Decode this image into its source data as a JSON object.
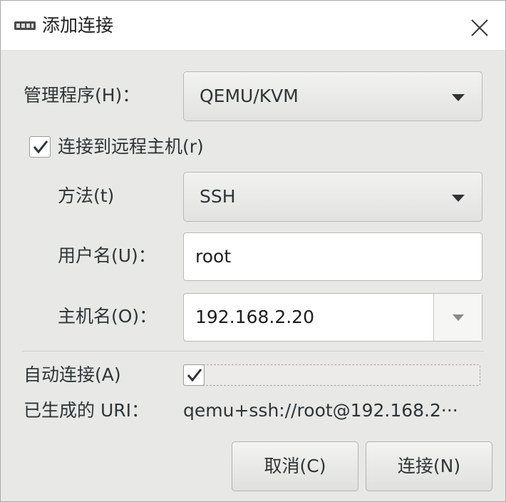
{
  "window": {
    "title": "添加连接",
    "icon": "monitor-icon",
    "close_icon": "close-icon"
  },
  "form": {
    "hypervisor": {
      "label": "管理程序(H)：",
      "value": "QEMU/KVM"
    },
    "remote": {
      "label": "连接到远程主机(r)",
      "checked": true
    },
    "method": {
      "label": "方法(t)",
      "value": "SSH"
    },
    "username": {
      "label": "用户名(U)：",
      "value": "root"
    },
    "hostname": {
      "label": "主机名(O)：",
      "value": "192.168.2.20"
    },
    "autoconnect": {
      "label": "自动连接(A)",
      "checked": true
    },
    "uri": {
      "label": "已生成的 URI：",
      "value": "qemu+ssh://root@192.168.2···"
    }
  },
  "buttons": {
    "cancel": "取消(C)",
    "connect": "连接(N)"
  },
  "colors": {
    "window_bg": "#e8e8e7",
    "titlebar_bg": "#ffffff",
    "text": "#2e3436"
  }
}
